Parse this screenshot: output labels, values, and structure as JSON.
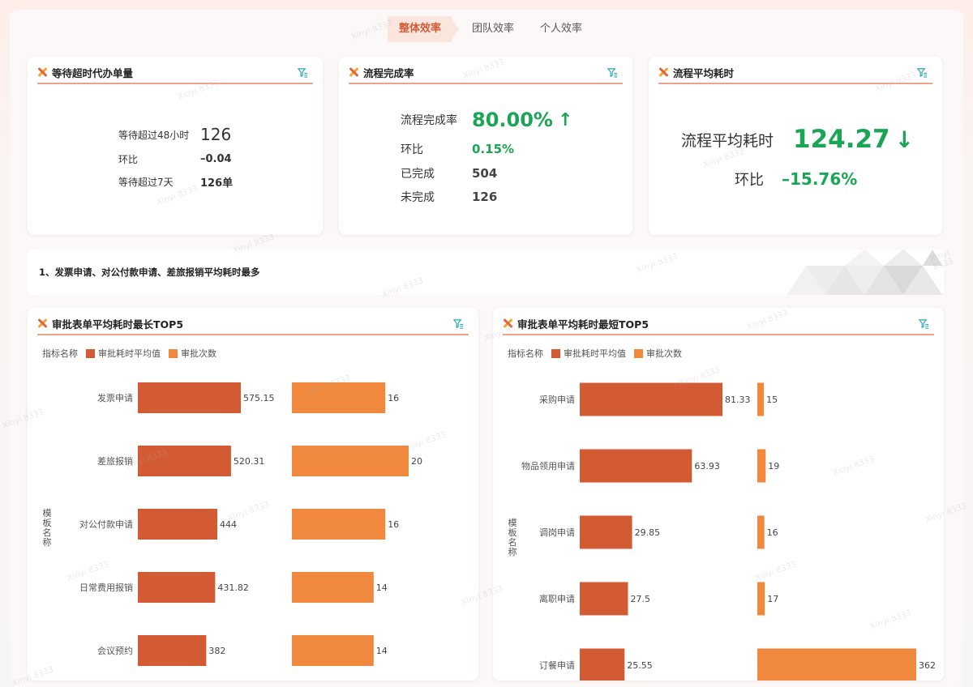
{
  "tabs": [
    {
      "label": "整体效率",
      "active": true
    },
    {
      "label": "团队效率",
      "active": false
    },
    {
      "label": "个人效率",
      "active": false
    }
  ],
  "card1": {
    "title": "等待超时代办单量",
    "rows": [
      {
        "label": "等待超过48小时",
        "value": "126"
      },
      {
        "label": "环比",
        "value": "–0.04"
      },
      {
        "label": "等待超过7天",
        "value": "126单"
      }
    ]
  },
  "card2": {
    "title": "流程完成率",
    "main_label": "流程完成率",
    "main_value": "80.00%",
    "main_arrow": "↑",
    "rows": [
      {
        "label": "环比",
        "value": "0.15%"
      },
      {
        "label": "已完成",
        "value": "504"
      },
      {
        "label": "未完成",
        "value": "126"
      }
    ]
  },
  "card3": {
    "title": "流程平均耗时",
    "main_label": "流程平均耗时",
    "main_value": "124.27",
    "main_arrow": "↓",
    "ratio_label": "环比",
    "ratio_value": "–15.76%"
  },
  "summary": "1、发票申请、对公付款申请、差旅报销平均耗时最多",
  "colors": {
    "bar1": "#d35b34",
    "bar2": "#f0883e",
    "green": "#1aa655",
    "accent": "#f0a487"
  },
  "watermark": "Xinyi 8333",
  "chart_data": [
    {
      "type": "bar",
      "title": "审批表单平均耗时最长TOP5",
      "legend_title": "指标名称",
      "ylabel": "模板名称",
      "categories": [
        "发票申请",
        "差旅报销",
        "对公付款申请",
        "日常费用报销",
        "会议预约"
      ],
      "series": [
        {
          "name": "审批耗时平均值",
          "values": [
            575.15,
            520.31,
            444,
            431.82,
            382
          ]
        },
        {
          "name": "审批次数",
          "values": [
            16,
            20,
            16,
            14,
            14
          ]
        }
      ],
      "labels": [
        [
          "575.15",
          "520.31",
          "444",
          "431.82",
          "382"
        ],
        [
          "16",
          "20",
          "16",
          "14",
          "14"
        ]
      ]
    },
    {
      "type": "bar",
      "title": "审批表单平均耗时最短TOP5",
      "legend_title": "指标名称",
      "ylabel": "模板名称",
      "categories": [
        "采购申请",
        "物品领用申请",
        "调岗申请",
        "离职申请",
        "订餐申请"
      ],
      "series": [
        {
          "name": "审批耗时平均值",
          "values": [
            81.33,
            63.93,
            29.85,
            27.5,
            25.55
          ]
        },
        {
          "name": "审批次数",
          "values": [
            15,
            19,
            16,
            17,
            362
          ]
        }
      ],
      "labels": [
        [
          "81.33",
          "63.93",
          "29.85",
          "27.5",
          "25.55"
        ],
        [
          "15",
          "19",
          "16",
          "17",
          "362"
        ]
      ]
    }
  ]
}
